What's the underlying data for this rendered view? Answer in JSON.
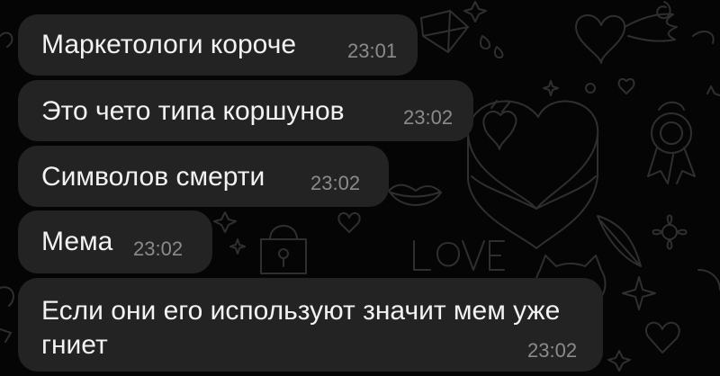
{
  "chat": {
    "messages": [
      {
        "text": "Маркетологи короче",
        "time": "23:01"
      },
      {
        "text": "Это чето типа коршунов",
        "time": "23:02"
      },
      {
        "text": "Символов смерти",
        "time": "23:02"
      },
      {
        "text": "Мема",
        "time": "23:02"
      },
      {
        "text": "Если они его используют значит мем уже гниет",
        "time": "23:02"
      }
    ]
  },
  "colors": {
    "background": "#050505",
    "bubble": "#232323",
    "text": "#f2f2f2",
    "time": "#8b8b8b",
    "doodle": "#2f2f2f"
  },
  "background_doodles": [
    "winged-heart-icon",
    "heart-cake-icon",
    "gem-icon",
    "ribbon-badge-icon",
    "padlock-icon",
    "lips-icon",
    "love-text-icon",
    "flower-icon",
    "cat-icon",
    "stars-icon",
    "feather-icon"
  ]
}
